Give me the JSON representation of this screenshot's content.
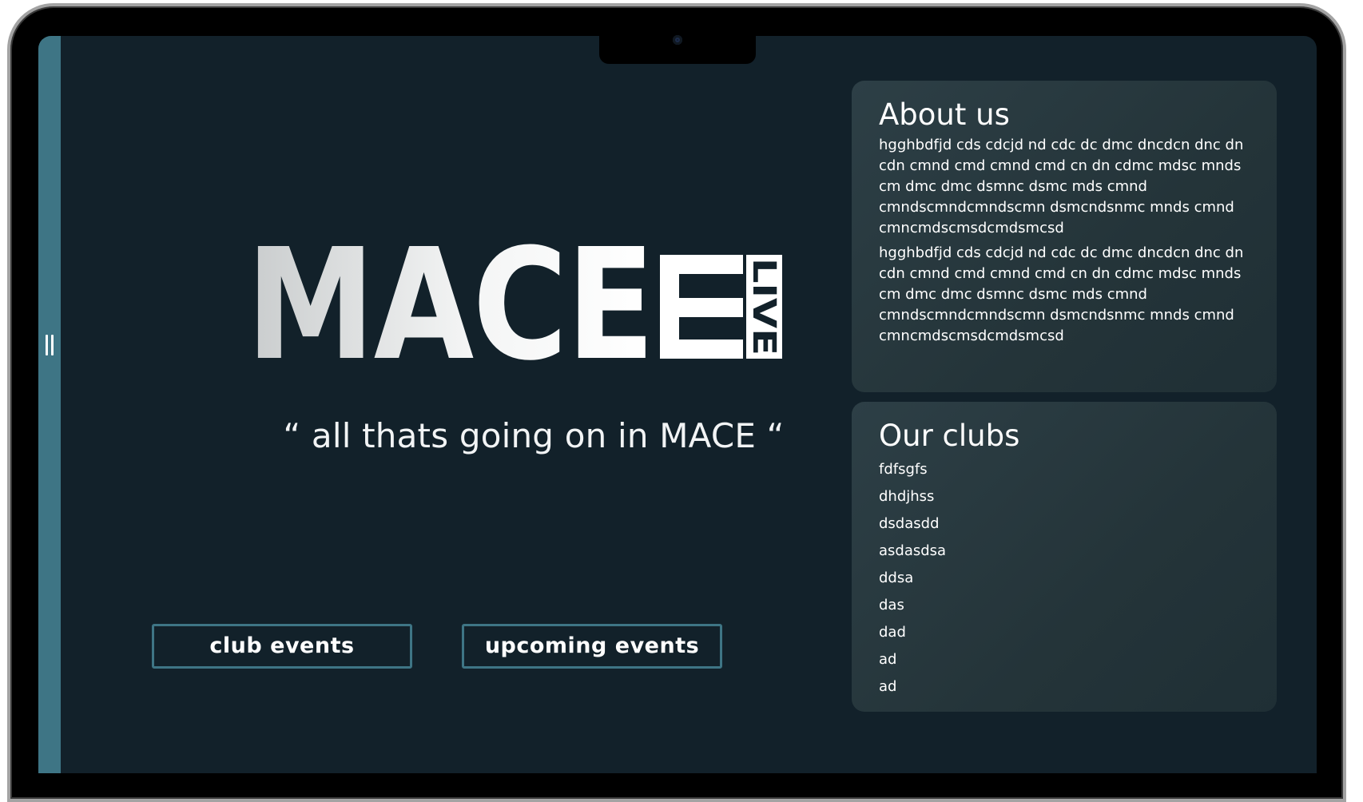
{
  "app": {
    "brand": {
      "word": "MACE",
      "badge": "LIVE"
    },
    "tagline": "“ all thats going on in MACE “"
  },
  "sidebar": {
    "toggle_icon": "menu-toggle-icon"
  },
  "actions": {
    "club_events_label": "club events",
    "upcoming_events_label": "upcoming events"
  },
  "about": {
    "title": "About us",
    "paragraphs": [
      "hgghbdfjd cds cdcjd nd cdc dc dmc dncdcn dnc dn cdn cmnd cmd cmnd cmd cn dn cdmc mdsc mnds cm dmc dmc dsmnc dsmc mds cmnd cmndscmndcmndscmn  dsmcndsnmc mnds cmnd cmncmdscmsdcmdsmcsd",
      "hgghbdfjd cds cdcjd nd cdc dc dmc dncdcn dnc dn cdn cmnd cmd cmnd cmd cn dn cdmc mdsc mnds cm dmc dmc dsmnc dsmc mds cmnd cmndscmndcmndscmn  dsmcndsnmc mnds cmnd cmncmdscmsdcmdsmcsd"
    ]
  },
  "clubs": {
    "title": "Our clubs",
    "items": [
      "fdfsgfs",
      "dhdjhss",
      "dsdasdd",
      "asdasdsa",
      "ddsa",
      "das",
      "dad",
      "ad",
      "ad"
    ]
  },
  "colors": {
    "background": "#12212a",
    "accent": "#3e7585",
    "panel": "#2b3b42",
    "text": "#ffffff"
  }
}
